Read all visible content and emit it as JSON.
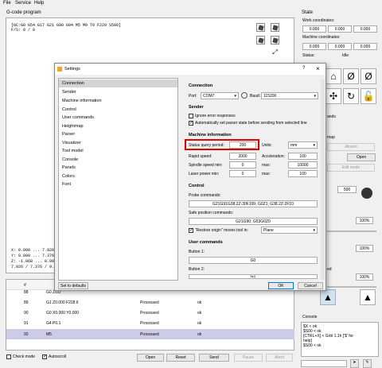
{
  "menu": [
    "File",
    "Service",
    "Help"
  ],
  "gcode": {
    "title": "G-code program",
    "status_lines": [
      "[GC:G0 G54 G17 G21 G90 G94 M5 M9 T0 F229 S500]",
      "F/S: 0 / 0"
    ],
    "bounds": [
      "X: 0.000 ... 7.926",
      "Y: 0.000 ... 7.376",
      "Z: -1.068 ... 0.000",
      "7.926 / 7.376 / 9.068"
    ]
  },
  "table": {
    "header_num": "#",
    "rows": [
      {
        "num": "88",
        "cmd": "G0 Z0.0",
        "state": "",
        "resp": ""
      },
      {
        "num": "89",
        "cmd": "G1 Z0.000 F228.6",
        "state": "Processed",
        "resp": "ok"
      },
      {
        "num": "90",
        "cmd": "G0 X0.000 Y0.000",
        "state": "Processed",
        "resp": "ok"
      },
      {
        "num": "91",
        "cmd": "G4 P0.1",
        "state": "Processed",
        "resp": "ok"
      },
      {
        "num": "92",
        "cmd": "M5",
        "state": "Processed",
        "resp": "ok"
      }
    ]
  },
  "bottom": {
    "check_mode": "Check mode",
    "autoscroll": "Autoscroll",
    "open": "Open",
    "reset": "Reset",
    "send": "Send",
    "pause": "Pause",
    "abort": "Abort"
  },
  "state": {
    "title": "State",
    "work_label": "Work coordinates:",
    "machine_label": "Machine coordinates:",
    "work": [
      "0.000",
      "0.000",
      "0.000"
    ],
    "machine": [
      "0.000",
      "0.000",
      "0.000"
    ],
    "status_label": "Status:",
    "status_value": "Idle"
  },
  "right_fragments": {
    "cmds": "ands",
    "map": "map",
    "absent": "Absent",
    "open": "Open",
    "edit_mode": "Edit mode",
    "spindle": "500",
    "feed1": "100%",
    "feed2": "100%",
    "feed3": "100%",
    "rapid_label": "ed",
    "console_title": "Console",
    "console_lines": [
      "$X < ok",
      "$S00 < ok",
      "[CTRL+X] < Grbl 1.1h ['$' for",
      "help]",
      "$S00 < ok"
    ]
  },
  "dialog": {
    "title": "Settings",
    "help": "?",
    "close": "×",
    "nav": [
      "Connection",
      "Sender",
      "Machine information",
      "Control",
      "User commands",
      "Heightmap",
      "Parser",
      "Visualizer",
      "Tool model",
      "Console",
      "Panels",
      "Colors",
      "Font"
    ],
    "set_defaults": "Set to defaults",
    "ok": "OK",
    "cancel": "Cancel",
    "connection": {
      "title": "Connection",
      "port_label": "Port:",
      "port_value": "COM7",
      "baud_label": "Baud:",
      "baud_value": "115200"
    },
    "sender": {
      "title": "Sender",
      "ignore_errors": "Ignore error responses",
      "auto_parser": "Automatically set parser state before sending from selected line"
    },
    "machine": {
      "title": "Machine information",
      "status_label": "Status query period:",
      "status_value": "200",
      "units_label": "Units:",
      "units_value": "mm",
      "rapid_label": "Rapid speed:",
      "rapid_value": "2000",
      "accel_label": "Acceleration:",
      "accel_value": "100",
      "spindle_min_label": "Spindle speed min:",
      "spindle_min_value": "0",
      "spindle_max_label": "max:",
      "spindle_max_value": "10000",
      "laser_min_label": "Laser power min:",
      "laser_min_value": "0",
      "laser_max_label": "max:",
      "laser_max_value": "100"
    },
    "control": {
      "title": "Control",
      "probe_label": "Probe commands:",
      "probe_value": "G21G91G38.2Z-30F100; G0Z1; G38.2Z-2F10",
      "safe_label": "Safe position commands:",
      "safe_value": "G21G90; G53G0Z0",
      "restore_label": "\"Restore origin\" moves tool in:",
      "restore_value": "Plane"
    },
    "user": {
      "title": "User commands",
      "b1_label": "Button 1:",
      "b1_value": "G0",
      "b2_label": "Button 2:",
      "b2_value": "G1"
    }
  }
}
